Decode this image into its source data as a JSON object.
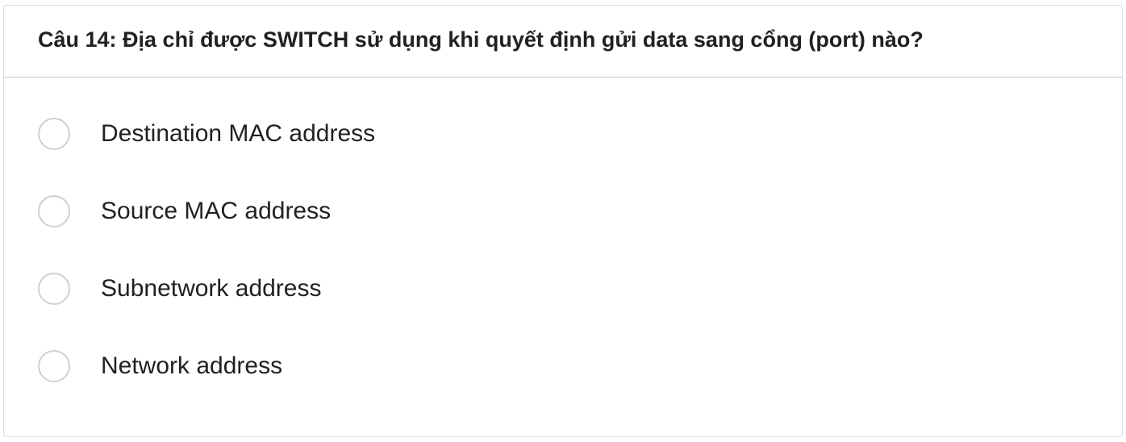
{
  "question": {
    "title": "Câu 14: Địa chỉ được SWITCH sử dụng khi quyết định gửi data sang cổng (port) nào?"
  },
  "options": [
    {
      "label": "Destination MAC address",
      "selected": false
    },
    {
      "label": "Source MAC address",
      "selected": false
    },
    {
      "label": "Subnetwork address",
      "selected": false
    },
    {
      "label": "Network address",
      "selected": false
    }
  ],
  "colors": {
    "border": "#dadce0",
    "divider": "#e0e0e0",
    "radio_border": "#d0d0d0",
    "text": "#202124"
  }
}
